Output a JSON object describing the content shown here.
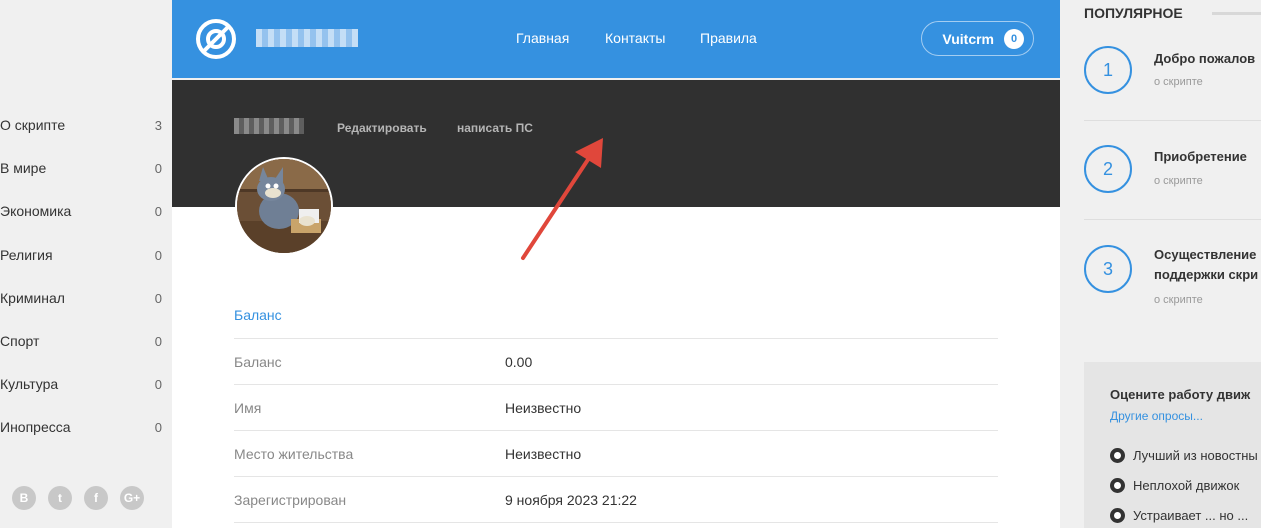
{
  "categories": [
    {
      "label": "О скрипте",
      "count": "3"
    },
    {
      "label": "В мире",
      "count": "0"
    },
    {
      "label": "Экономика",
      "count": "0"
    },
    {
      "label": "Религия",
      "count": "0"
    },
    {
      "label": "Криминал",
      "count": "0"
    },
    {
      "label": "Спорт",
      "count": "0"
    },
    {
      "label": "Культура",
      "count": "0"
    },
    {
      "label": "Инопресса",
      "count": "0"
    }
  ],
  "socials": [
    "B",
    "t",
    "f",
    "G+"
  ],
  "header": {
    "nav": [
      "Главная",
      "Контакты",
      "Правила"
    ],
    "user_name": "Vuitcrm",
    "user_badge": "0"
  },
  "profile": {
    "edit_link": "Редактировать",
    "pm_link": "написать ПС",
    "section_title": "Баланс",
    "rows": [
      {
        "key": "Баланс",
        "value": "0.00"
      },
      {
        "key": "Имя",
        "value": "Неизвестно"
      },
      {
        "key": "Место жительства",
        "value": "Неизвестно"
      },
      {
        "key": "Зарегистрирован",
        "value": "9 ноября 2023 21:22"
      }
    ]
  },
  "popular": {
    "heading": "ПОПУЛЯРНОЕ",
    "items": [
      {
        "num": "1",
        "title_lines": [
          "Добро пожалов"
        ],
        "sub": "о скрипте"
      },
      {
        "num": "2",
        "title_lines": [
          "Приобретение"
        ],
        "sub": "о скрипте"
      },
      {
        "num": "3",
        "title_lines": [
          "Осуществление",
          "поддержки скри"
        ],
        "sub": "о скрипте"
      }
    ]
  },
  "poll": {
    "question": "Оцените работу движ",
    "other_link": "Другие опросы...",
    "options": [
      "Лучший из новостны",
      "Неплохой движок",
      "Устраивает ... но ..."
    ]
  },
  "colors": {
    "accent": "#3591e0",
    "banner": "#303030",
    "arrow": "#e0473b"
  }
}
